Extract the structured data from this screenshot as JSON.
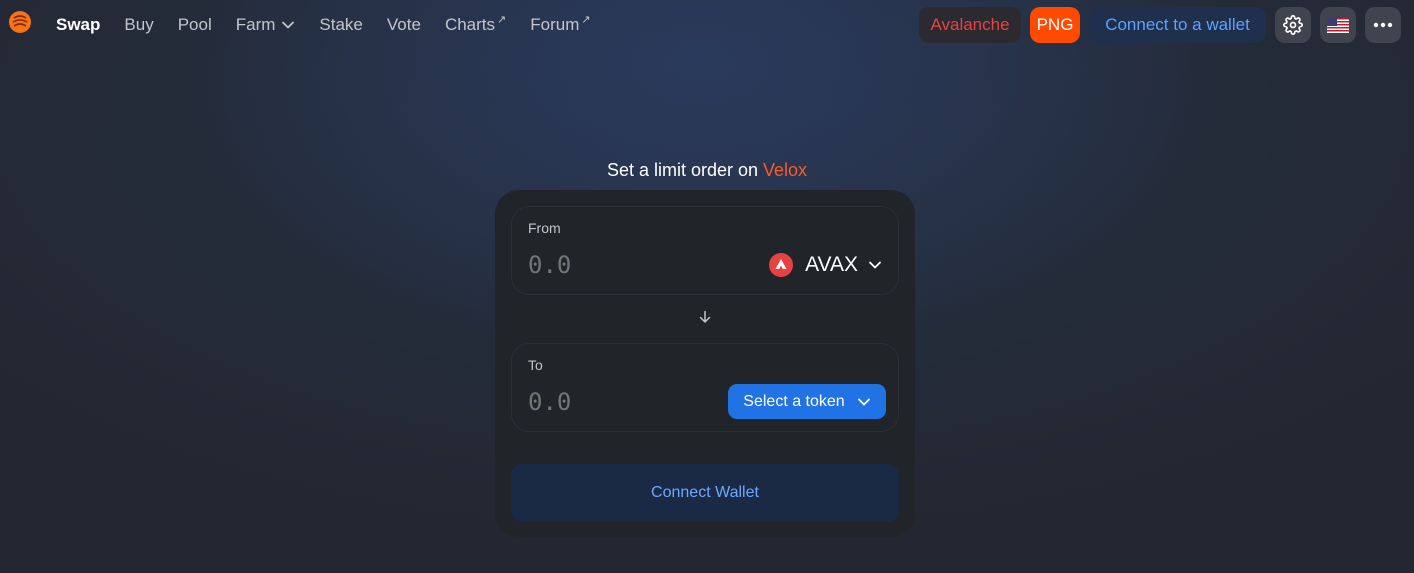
{
  "nav": {
    "items": [
      {
        "label": "Swap",
        "active": true
      },
      {
        "label": "Buy"
      },
      {
        "label": "Pool"
      },
      {
        "label": "Farm",
        "dropdown": true
      },
      {
        "label": "Stake"
      },
      {
        "label": "Vote"
      },
      {
        "label": "Charts",
        "external": true,
        "ext_glyph": "↗"
      },
      {
        "label": "Forum",
        "external": true,
        "ext_glyph": "↗"
      }
    ],
    "network_label": "Avalanche",
    "token_badge": "PNG",
    "connect_label": "Connect to a wallet",
    "icons": [
      "settings-gear-icon",
      "us-flag-icon",
      "more-dots-icon"
    ]
  },
  "page": {
    "title_prefix": "Set a limit order on ",
    "title_brand": "Velox"
  },
  "from_panel": {
    "label": "From",
    "placeholder": "0.0",
    "token_symbol": "AVAX"
  },
  "to_panel": {
    "label": "To",
    "placeholder": "0.0",
    "select_label": "Select a token"
  },
  "connect_wallet_label": "Connect Wallet",
  "colors": {
    "accent_orange": "#ff4a00",
    "avalanche_red": "#e84142",
    "primary_blue": "#2172e5",
    "link_blue": "#5aa3ff"
  }
}
